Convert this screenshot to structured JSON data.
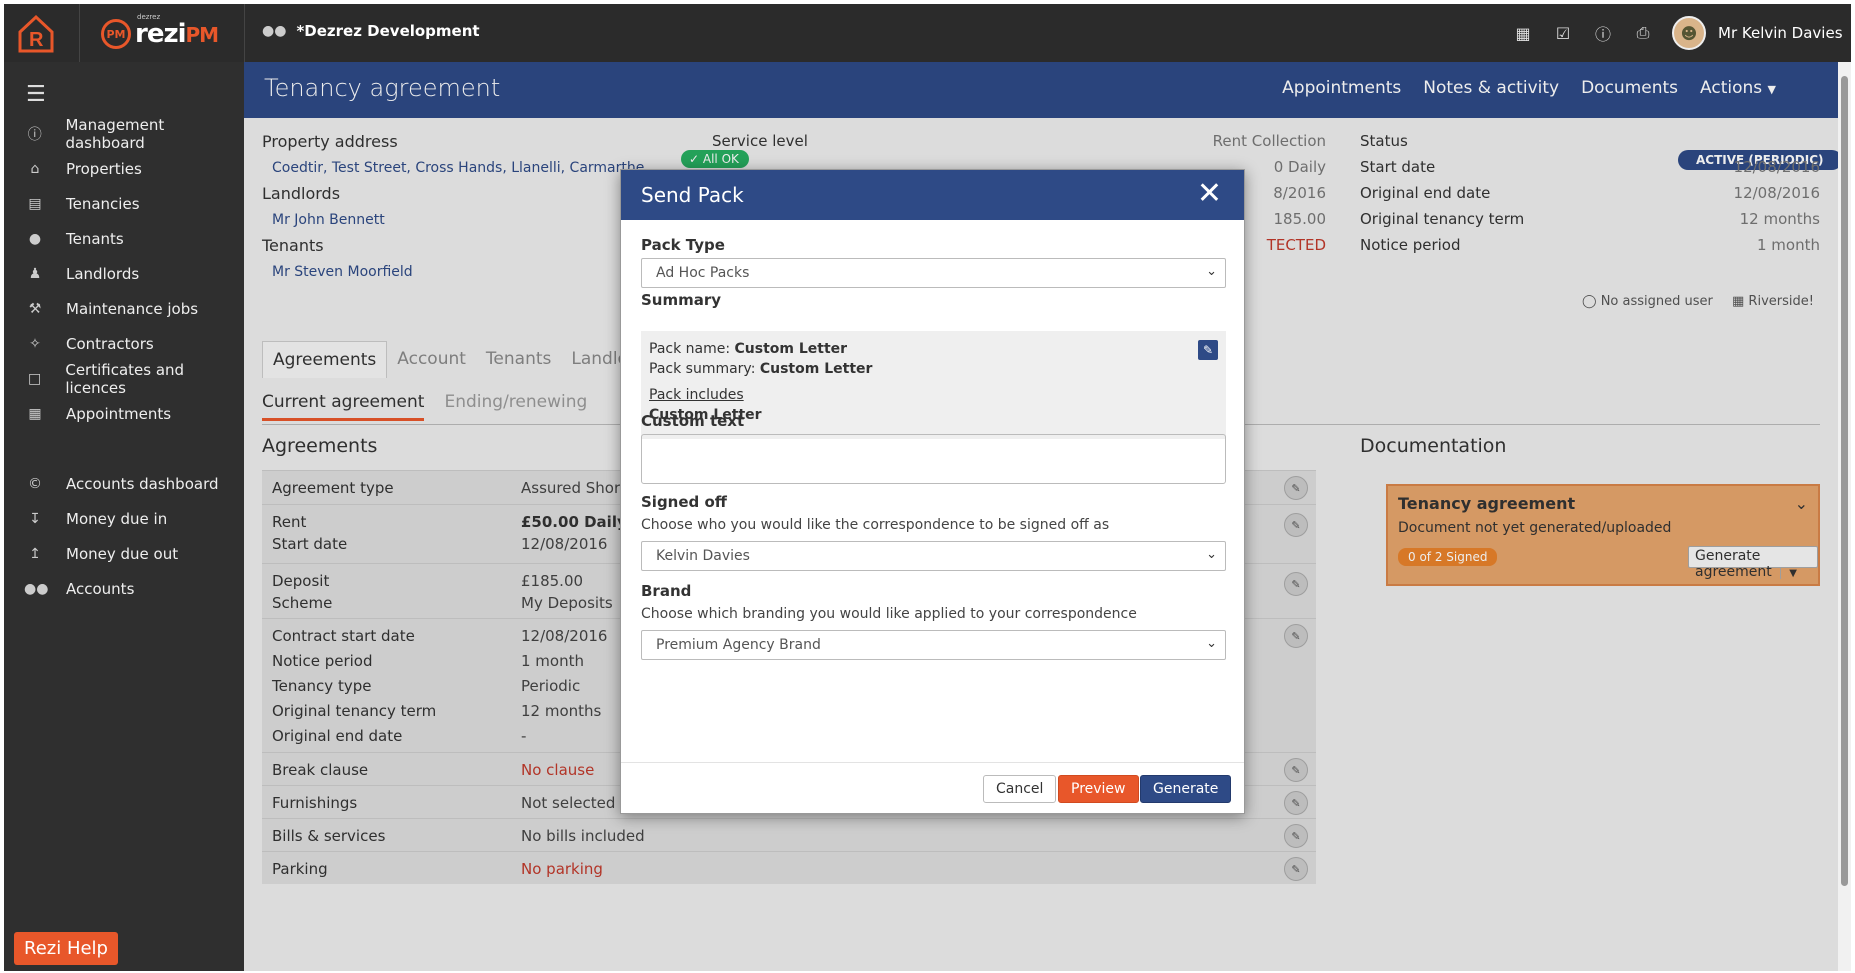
{
  "topbar": {
    "logo_sub": "dezrez",
    "logo_main": "rezi",
    "logo_pm": "PM",
    "client_name": "*Dezrez Development",
    "user_name": "Mr Kelvin Davies"
  },
  "sidebar": {
    "items": [
      {
        "label": "Management dashboard",
        "icon": "info-icon"
      },
      {
        "label": "Properties",
        "icon": "home-icon"
      },
      {
        "label": "Tenancies",
        "icon": "document-icon"
      },
      {
        "label": "Tenants",
        "icon": "person-icon"
      },
      {
        "label": "Landlords",
        "icon": "landlord-icon"
      },
      {
        "label": "Maintenance jobs",
        "icon": "tools-icon"
      },
      {
        "label": "Contractors",
        "icon": "contractor-icon"
      },
      {
        "label": "Certificates and licences",
        "icon": "certificate-icon"
      },
      {
        "label": "Appointments",
        "icon": "calendar-icon"
      }
    ],
    "items2": [
      {
        "label": "Accounts dashboard",
        "icon": "copyright-icon"
      },
      {
        "label": "Money due in",
        "icon": "inbox-in-icon"
      },
      {
        "label": "Money due out",
        "icon": "inbox-out-icon"
      },
      {
        "label": "Accounts",
        "icon": "people-icon"
      }
    ],
    "help_label": "Rezi Help"
  },
  "header": {
    "title": "Tenancy agreement",
    "nav": [
      "Appointments",
      "Notes & activity",
      "Documents",
      "Actions"
    ]
  },
  "property": {
    "address_label": "Property address",
    "address": "Coedtir, Test Street, Cross Hands, Llanelli, Carmarthe",
    "ok_badge": "All OK",
    "landlords_label": "Landlords",
    "landlord": "Mr John Bennett",
    "tenants_label": "Tenants",
    "tenant": "Mr Steven Moorfield"
  },
  "service": {
    "label": "Service level",
    "value": "Rent Collection",
    "v2": "0 Daily",
    "v3": "8/2016",
    "v4": "185.00",
    "v5": "TECTED"
  },
  "status": {
    "status_label": "Status",
    "status_badge": "ACTIVE (PERIODIC)",
    "rows": [
      {
        "k": "Start date",
        "v": "12/08/2016"
      },
      {
        "k": "Original end date",
        "v": "12/08/2016"
      },
      {
        "k": "Original tenancy term",
        "v": "12 months"
      },
      {
        "k": "Notice period",
        "v": "1 month"
      }
    ],
    "assigned": "No assigned user",
    "branch": "Riverside!"
  },
  "tabs": [
    "Agreements",
    "Account",
    "Tenants",
    "Landlor"
  ],
  "subtabs": [
    "Current agreement",
    "Ending/renewing"
  ],
  "agreements": {
    "title": "Agreements",
    "rows": [
      {
        "k": [
          "Agreement type"
        ],
        "v": [
          "Assured Shor"
        ]
      },
      {
        "k": [
          "Rent",
          "Start date"
        ],
        "v": [
          "£50.00 Daily",
          "12/08/2016"
        ]
      },
      {
        "k": [
          "Deposit",
          "Scheme"
        ],
        "v": [
          "£185.00",
          "My Deposits"
        ]
      },
      {
        "k": [
          "Contract start date",
          "Notice period",
          "Tenancy type",
          "Original tenancy term",
          "Original end date"
        ],
        "v": [
          "12/08/2016",
          "1 month",
          "Periodic",
          "12 months",
          "-"
        ]
      },
      {
        "k": [
          "Break clause"
        ],
        "v": [
          "No clause"
        ]
      },
      {
        "k": [
          "Furnishings"
        ],
        "v": [
          "Not selected"
        ]
      },
      {
        "k": [
          "Bills & services"
        ],
        "v": [
          "No bills included"
        ]
      },
      {
        "k": [
          "Parking"
        ],
        "v": [
          "No parking"
        ]
      }
    ]
  },
  "documentation": {
    "title": "Documentation",
    "card_title": "Tenancy agreement",
    "card_sub": "Document not yet generated/uploaded",
    "signed": "0 of 2 Signed",
    "generate": "Generate agreement"
  },
  "modal": {
    "title": "Send Pack",
    "pack_type_label": "Pack Type",
    "pack_type_value": "Ad Hoc Packs",
    "summary_label": "Summary",
    "pack_name_label": "Pack name: ",
    "pack_name": "Custom Letter",
    "pack_summary_label": "Pack summary: ",
    "pack_summary": "Custom Letter",
    "pack_includes_label": "Pack includes",
    "pack_includes": "Custom Letter",
    "custom_text_label": "Custom text",
    "signed_off_label": "Signed off",
    "signed_off_help": "Choose who you would like the correspondence to be signed off as",
    "signed_off_value": "Kelvin Davies",
    "brand_label": "Brand",
    "brand_help": "Choose which branding you would like applied to your correspondence",
    "brand_value": "Premium Agency Brand",
    "cancel": "Cancel",
    "preview": "Preview",
    "generate": "Generate"
  },
  "colors": {
    "header": "#2e4a86",
    "accent": "#e8572a",
    "ok": "#27ae60"
  }
}
